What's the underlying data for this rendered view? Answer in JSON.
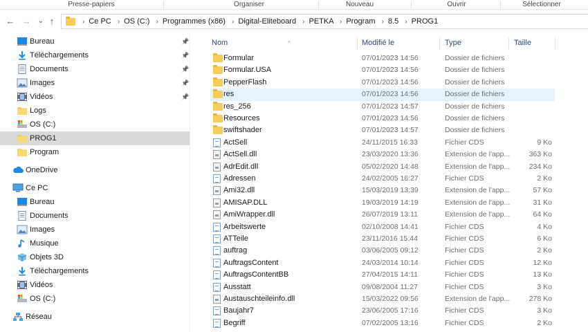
{
  "ribbon": {
    "groups": [
      "Presse-papiers",
      "Organiser",
      "Nouveau",
      "Ouvrir",
      "Sélectionner"
    ]
  },
  "nav": {
    "back": "←",
    "forward": "→",
    "recent": "⌄",
    "up": "↑"
  },
  "address": {
    "segments": [
      "Ce PC",
      "OS (C:)",
      "Programmes (x86)",
      "Digital-Eliteboard",
      "PETKA",
      "Program",
      "8.5",
      "PROG1"
    ],
    "separator": "›"
  },
  "sidebar": {
    "quick_access": [
      {
        "label": "Bureau",
        "icon": "desktop-icon",
        "pinned": true
      },
      {
        "label": "Téléchargements",
        "icon": "download-icon",
        "pinned": true
      },
      {
        "label": "Documents",
        "icon": "documents-icon",
        "pinned": true
      },
      {
        "label": "Images",
        "icon": "images-icon",
        "pinned": true
      },
      {
        "label": "Vidéos",
        "icon": "videos-icon",
        "pinned": true
      },
      {
        "label": "Logs",
        "icon": "folder-icon",
        "pinned": false
      },
      {
        "label": "OS (C:)",
        "icon": "drive-icon",
        "pinned": false
      },
      {
        "label": "PROG1",
        "icon": "folder-icon",
        "pinned": false,
        "selected": true
      },
      {
        "label": "Program",
        "icon": "folder-icon",
        "pinned": false
      }
    ],
    "onedrive": {
      "label": "OneDrive",
      "icon": "cloud-icon"
    },
    "this_pc": {
      "label": "Ce PC",
      "icon": "pc-icon"
    },
    "pc_items": [
      {
        "label": "Bureau",
        "icon": "desktop-icon"
      },
      {
        "label": "Documents",
        "icon": "documents-icon"
      },
      {
        "label": "Images",
        "icon": "images-icon"
      },
      {
        "label": "Musique",
        "icon": "music-icon"
      },
      {
        "label": "Objets 3D",
        "icon": "cube-icon"
      },
      {
        "label": "Téléchargements",
        "icon": "download-icon"
      },
      {
        "label": "Vidéos",
        "icon": "videos-icon"
      },
      {
        "label": "OS (C:)",
        "icon": "drive-icon"
      }
    ],
    "network": {
      "label": "Réseau",
      "icon": "network-icon"
    },
    "pin_glyph": "📌"
  },
  "columns": {
    "name": "Nom",
    "modified": "Modifié le",
    "type": "Type",
    "size": "Taille",
    "sort_glyph": "^"
  },
  "files": [
    {
      "name": "Formular",
      "date": "07/01/2023 14:56",
      "type": "Dossier de fichiers",
      "size": "",
      "kind": "folder"
    },
    {
      "name": "Formular.USA",
      "date": "07/01/2023 14:56",
      "type": "Dossier de fichiers",
      "size": "",
      "kind": "folder"
    },
    {
      "name": "PepperFlash",
      "date": "07/01/2023 14:56",
      "type": "Dossier de fichiers",
      "size": "",
      "kind": "folder"
    },
    {
      "name": "res",
      "date": "07/01/2023 14:56",
      "type": "Dossier de fichiers",
      "size": "",
      "kind": "folder",
      "hover": true
    },
    {
      "name": "res_256",
      "date": "07/01/2023 14:57",
      "type": "Dossier de fichiers",
      "size": "",
      "kind": "folder"
    },
    {
      "name": "Resources",
      "date": "07/01/2023 14:56",
      "type": "Dossier de fichiers",
      "size": "",
      "kind": "folder"
    },
    {
      "name": "swiftshader",
      "date": "07/01/2023 14:57",
      "type": "Dossier de fichiers",
      "size": "",
      "kind": "folder"
    },
    {
      "name": "ActSell",
      "date": "24/11/2015 16:33",
      "type": "Fichier CDS",
      "size": "9 Ko",
      "kind": "cds"
    },
    {
      "name": "ActSell.dll",
      "date": "23/03/2020 13:36",
      "type": "Extension de l'app...",
      "size": "363 Ko",
      "kind": "dll"
    },
    {
      "name": "AdrEdit.dll",
      "date": "05/02/2020 14:48",
      "type": "Extension de l'app...",
      "size": "234 Ko",
      "kind": "dll"
    },
    {
      "name": "Adressen",
      "date": "24/02/2005 16:27",
      "type": "Fichier CDS",
      "size": "2 Ko",
      "kind": "cds"
    },
    {
      "name": "Ami32.dll",
      "date": "15/03/2019 13:39",
      "type": "Extension de l'app...",
      "size": "57 Ko",
      "kind": "dll"
    },
    {
      "name": "AMISAP.DLL",
      "date": "19/03/2019 14:19",
      "type": "Extension de l'app...",
      "size": "31 Ko",
      "kind": "dll"
    },
    {
      "name": "AmiWrapper.dll",
      "date": "26/07/2019 13:11",
      "type": "Extension de l'app...",
      "size": "64 Ko",
      "kind": "dll"
    },
    {
      "name": "Arbeitswerte",
      "date": "02/10/2008 14:41",
      "type": "Fichier CDS",
      "size": "4 Ko",
      "kind": "cds"
    },
    {
      "name": "ATTeile",
      "date": "23/11/2016 15:44",
      "type": "Fichier CDS",
      "size": "6 Ko",
      "kind": "cds"
    },
    {
      "name": "auftrag",
      "date": "03/06/2005 09:12",
      "type": "Fichier CDS",
      "size": "2 Ko",
      "kind": "cds"
    },
    {
      "name": "AuftragsContent",
      "date": "24/03/2014 10:14",
      "type": "Fichier CDS",
      "size": "12 Ko",
      "kind": "cds"
    },
    {
      "name": "AuftragsContentBB",
      "date": "27/04/2015 14:11",
      "type": "Fichier CDS",
      "size": "13 Ko",
      "kind": "cds"
    },
    {
      "name": "Ausstatt",
      "date": "09/08/2004 11:27",
      "type": "Fichier CDS",
      "size": "3 Ko",
      "kind": "cds"
    },
    {
      "name": "Austauschteileinfo.dll",
      "date": "15/03/2022 09:56",
      "type": "Extension de l'app...",
      "size": "278 Ko",
      "kind": "dll"
    },
    {
      "name": "Baujahr7",
      "date": "23/06/2005 17:16",
      "type": "Fichier CDS",
      "size": "3 Ko",
      "kind": "cds"
    },
    {
      "name": "Begriff",
      "date": "07/02/2005 13:16",
      "type": "Fichier CDS",
      "size": "2 Ko",
      "kind": "cds"
    }
  ],
  "colors": {
    "selection": "#cce8ff",
    "hover": "#e5f3ff",
    "folder": "#f6cd59",
    "header_text": "#2b4b78"
  }
}
